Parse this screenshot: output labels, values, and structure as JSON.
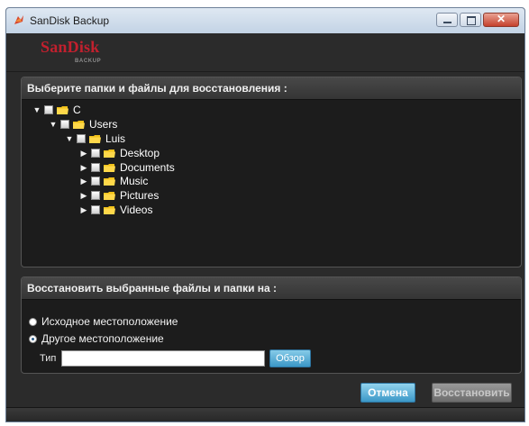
{
  "window": {
    "title": "SanDisk Backup",
    "close_glyph": "✕"
  },
  "logo": {
    "main": "SanDisk",
    "sub": "BACKUP"
  },
  "tree_panel": {
    "heading": "Выберите папки и файлы для восстановления :",
    "items": [
      {
        "label": "C",
        "expanded": true,
        "icon": "folder-icon"
      },
      {
        "label": "Users",
        "expanded": true,
        "icon": "folder-icon"
      },
      {
        "label": "Luis",
        "expanded": true,
        "icon": "folder-icon"
      },
      {
        "label": "Desktop",
        "expanded": false,
        "icon": "folder-icon"
      },
      {
        "label": "Documents",
        "expanded": false,
        "icon": "folder-icon"
      },
      {
        "label": "Music",
        "expanded": false,
        "icon": "folder-icon"
      },
      {
        "label": "Pictures",
        "expanded": false,
        "icon": "folder-icon"
      },
      {
        "label": "Videos",
        "expanded": false,
        "icon": "folder-icon"
      }
    ],
    "expanded_glyph": "▼",
    "collapsed_glyph": "▶"
  },
  "restore_panel": {
    "heading": "Восстановить выбранные файлы и папки на :",
    "options": [
      {
        "label": "Исходное местоположение",
        "selected": false
      },
      {
        "label": "Другое местоположение",
        "selected": true
      }
    ],
    "path_label": "Тип",
    "path_value": "",
    "browse_label": "Обзор"
  },
  "buttons": {
    "cancel": "Отмена",
    "restore": "Восстановить"
  },
  "colors": {
    "brand_red": "#c2202e",
    "accent_blue": "#3c97c6",
    "panel_bg": "#1c1c1c",
    "window_bg": "#2b2b2b",
    "folder_yellow": "#f2c21b"
  }
}
